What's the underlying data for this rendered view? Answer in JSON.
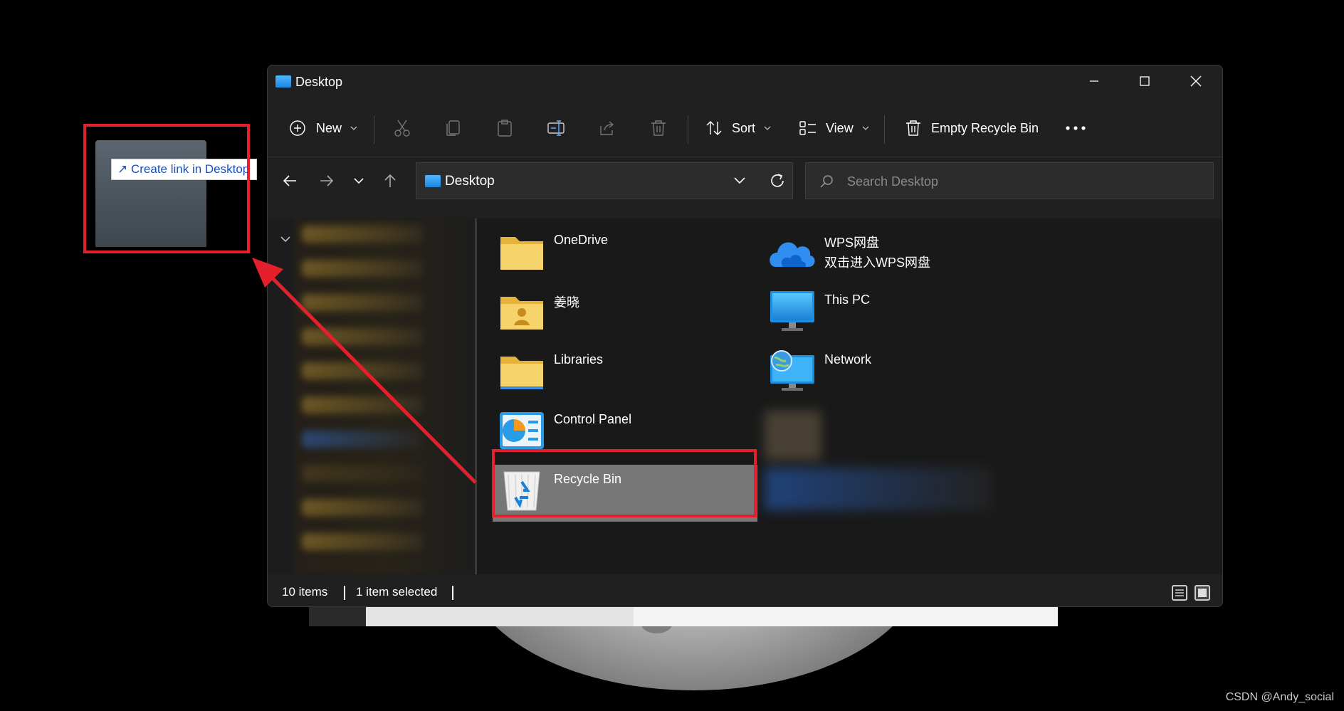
{
  "window": {
    "title": "Desktop"
  },
  "toolbar": {
    "new_label": "New",
    "sort_label": "Sort",
    "view_label": "View",
    "empty_recycle_bin_label": "Empty Recycle Bin"
  },
  "address": {
    "path": "Desktop"
  },
  "search": {
    "placeholder": "Search Desktop"
  },
  "items": [
    {
      "label": "OneDrive",
      "icon": "folder-icon"
    },
    {
      "label": "WPS网盘",
      "sub": "双击进入WPS网盘",
      "icon": "wps-cloud-icon"
    },
    {
      "label": "姜晓",
      "icon": "user-folder-icon"
    },
    {
      "label": "This PC",
      "icon": "monitor-icon"
    },
    {
      "label": "Libraries",
      "icon": "folder-icon"
    },
    {
      "label": "Network",
      "icon": "network-icon"
    },
    {
      "label": "Control Panel",
      "icon": "control-panel-icon"
    },
    {
      "label": "Recycle Bin",
      "icon": "recycle-bin-icon",
      "selected": true
    }
  ],
  "status": {
    "item_count": "10 items",
    "selected": "1 item selected"
  },
  "drag": {
    "tooltip": "↗ Create link in Desktop"
  },
  "colors": {
    "annotation_red": "#e3202b",
    "selection_gray": "#777777",
    "window_bg": "#202020"
  },
  "watermark": "CSDN @Andy_social"
}
